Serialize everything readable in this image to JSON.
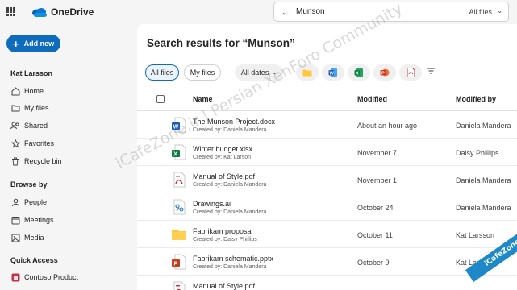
{
  "app": {
    "name": "OneDrive"
  },
  "search": {
    "query": "Munson",
    "scope": "All files"
  },
  "sidebar": {
    "add_new_label": "Add new",
    "user_name": "Kat Larsson",
    "items": [
      {
        "label": "Home",
        "icon": "home-icon"
      },
      {
        "label": "My files",
        "icon": "folder-icon"
      },
      {
        "label": "Shared",
        "icon": "people-icon"
      },
      {
        "label": "Favorites",
        "icon": "star-icon"
      },
      {
        "label": "Recycle bin",
        "icon": "trash-icon"
      }
    ],
    "browse_title": "Browse by",
    "browse_items": [
      {
        "label": "People",
        "icon": "person-icon"
      },
      {
        "label": "Meetings",
        "icon": "calendar-icon"
      },
      {
        "label": "Media",
        "icon": "image-icon"
      }
    ],
    "quick_access_title": "Quick Access",
    "quick_items": [
      {
        "label": "Contoso Product",
        "icon": "site-icon"
      }
    ]
  },
  "main": {
    "title": "Search results for “Munson”",
    "filters": {
      "all_files": "All files",
      "my_files": "My files",
      "dates": "All dates"
    },
    "columns": {
      "name": "Name",
      "modified": "Modified",
      "modified_by": "Modified by"
    },
    "files": [
      {
        "name": "The Munson Project.docx",
        "sub": "Created by: Daniela Mandera",
        "modified": "About an hour ago",
        "by": "Daniela Mandera",
        "icon": "word-icon"
      },
      {
        "name": "Winter budget.xlsx",
        "sub": "Created by: Kat Larson",
        "modified": "November 7",
        "by": "Daisy Phillips",
        "icon": "excel-icon"
      },
      {
        "name": "Manual of Style.pdf",
        "sub": "Created by: Daniela Mandera",
        "modified": "November 1",
        "by": "Daniela Mandera",
        "icon": "pdf-icon"
      },
      {
        "name": "Drawings.ai",
        "sub": "Created by: Daniela Mandera",
        "modified": "October 24",
        "by": "Daniela Mandera",
        "icon": "drawing-icon"
      },
      {
        "name": "Fabrikam proposal",
        "sub": "Created by: Daisy Phillips",
        "modified": "October 11",
        "by": "Kat Larsson",
        "icon": "folder-icon"
      },
      {
        "name": "Fabrikam schematic.pptx",
        "sub": "Created by: Daniela Mandera",
        "modified": "October 9",
        "by": "Kat Larsson",
        "icon": "powerpoint-icon"
      },
      {
        "name": "Manual of Style.pdf",
        "sub": "",
        "modified": "",
        "by": "",
        "icon": "pdf-icon"
      }
    ]
  },
  "watermark": {
    "text": "iCafeZone.ir | Persian XenForo Community",
    "badge": "iCafeZone"
  },
  "colors": {
    "accent": "#0f6cbd",
    "word": "#185abd",
    "excel": "#107c41",
    "powerpoint": "#c43e1c",
    "pdf": "#d13438",
    "folder": "#ffc83d"
  }
}
